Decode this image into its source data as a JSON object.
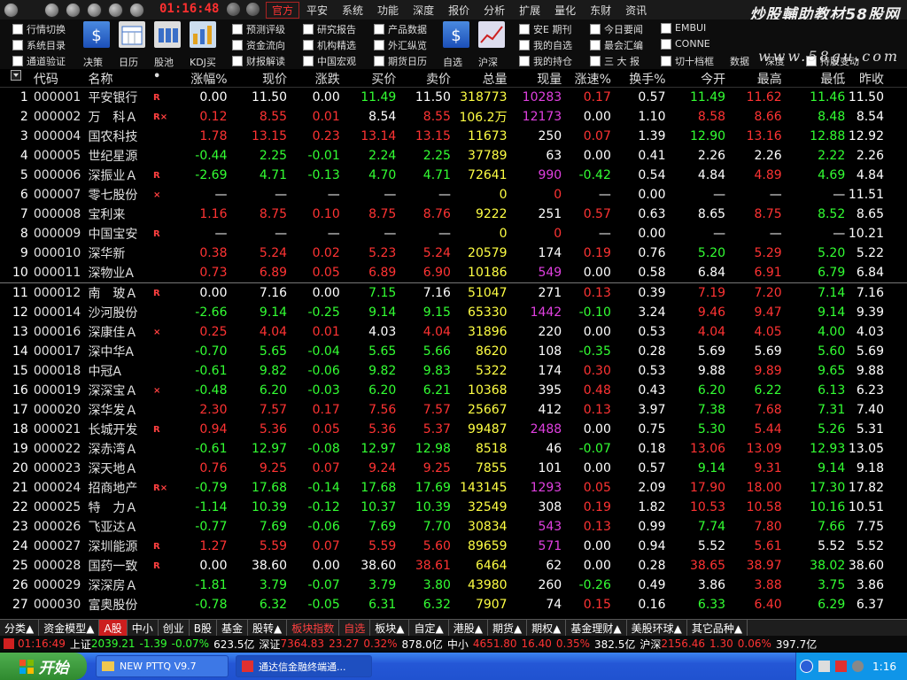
{
  "titlebar": {
    "clock": "01:16:48",
    "menu": [
      "官方",
      "平安",
      "系统",
      "功能",
      "深度",
      "报价",
      "分析",
      "扩展",
      "量化",
      "东财",
      "资讯"
    ],
    "brand": "炒股輔助教材58股网",
    "brand_url": "www.58gu.com"
  },
  "toolbar": {
    "checks_col1": [
      "行情切换",
      "系统目录",
      "通道验证"
    ],
    "tools1": [
      "决策",
      "日历",
      "股池",
      "KDJ买"
    ],
    "checks_col2": [
      "预测评级",
      "资金流向",
      "财报解读"
    ],
    "checks_col3": [
      "研究报告",
      "机构精选",
      "中国宏观"
    ],
    "checks_col4": [
      "产品数据",
      "外汇纵览",
      "期货日历"
    ],
    "tools2": [
      "自选",
      "沪深"
    ],
    "checks_col5": [
      "安E 期刊",
      "我的自选",
      "我的持仓"
    ],
    "checks_col6": [
      "今日要闻",
      "最会汇编",
      "三 大 报"
    ],
    "checks_col7": [
      "EMBUI",
      "CONNE",
      "切十档框"
    ],
    "extra_labels": [
      "数据",
      "深度"
    ],
    "check_last": "持股变动"
  },
  "columns": [
    "代码",
    "名称",
    "•",
    "涨幅%",
    "现价",
    "涨跌",
    "买价",
    "卖价",
    "总量",
    "现量",
    "涨速%",
    "换手%",
    "今开",
    "最高",
    "最低",
    "昨收"
  ],
  "rows": [
    {
      "i": "1",
      "code": "000001",
      "name": "平安银行",
      "mk": "R",
      "pct": "0.00",
      "price": "11.50",
      "chg": "0.00",
      "bid": "11.49",
      "ask": "11.50",
      "vol": "318773",
      "cur": "10283",
      "spd": "0.17",
      "turn": "0.57",
      "open": "11.49",
      "high": "11.62",
      "low": "11.46",
      "close": "11.50",
      "c": {
        "pct": "wh",
        "price": "wh",
        "chg": "wh",
        "bid": "dn",
        "ask": "wh",
        "vol": "yl",
        "cur": "mg",
        "spd": "up",
        "open": "dn",
        "high": "up",
        "low": "dn"
      }
    },
    {
      "i": "2",
      "code": "000002",
      "name": "万　科Ａ",
      "mk": "R×",
      "pct": "0.12",
      "price": "8.55",
      "chg": "0.01",
      "bid": "8.54",
      "ask": "8.55",
      "vol": "106.2万",
      "cur": "12173",
      "spd": "0.00",
      "turn": "1.10",
      "open": "8.58",
      "high": "8.66",
      "low": "8.48",
      "close": "8.54",
      "c": {
        "pct": "up",
        "price": "up",
        "chg": "up",
        "bid": "wh",
        "ask": "up",
        "vol": "yl",
        "cur": "mg",
        "spd": "wh",
        "open": "up",
        "high": "up",
        "low": "dn"
      }
    },
    {
      "i": "3",
      "code": "000004",
      "name": "国农科技",
      "mk": "",
      "pct": "1.78",
      "price": "13.15",
      "chg": "0.23",
      "bid": "13.14",
      "ask": "13.15",
      "vol": "11673",
      "cur": "250",
      "spd": "0.07",
      "turn": "1.39",
      "open": "12.90",
      "high": "13.16",
      "low": "12.88",
      "close": "12.92",
      "c": {
        "pct": "up",
        "price": "up",
        "chg": "up",
        "bid": "up",
        "ask": "up",
        "vol": "yl",
        "cur": "wh",
        "spd": "up",
        "open": "dn",
        "high": "up",
        "low": "dn"
      }
    },
    {
      "i": "4",
      "code": "000005",
      "name": "世纪星源",
      "mk": "",
      "pct": "-0.44",
      "price": "2.25",
      "chg": "-0.01",
      "bid": "2.24",
      "ask": "2.25",
      "vol": "37789",
      "cur": "63",
      "spd": "0.00",
      "turn": "0.41",
      "open": "2.26",
      "high": "2.26",
      "low": "2.22",
      "close": "2.26",
      "c": {
        "pct": "dn",
        "price": "dn",
        "chg": "dn",
        "bid": "dn",
        "ask": "dn",
        "vol": "yl",
        "cur": "wh",
        "spd": "wh",
        "open": "wh",
        "high": "wh",
        "low": "dn"
      }
    },
    {
      "i": "5",
      "code": "000006",
      "name": "深振业Ａ",
      "mk": "R",
      "pct": "-2.69",
      "price": "4.71",
      "chg": "-0.13",
      "bid": "4.70",
      "ask": "4.71",
      "vol": "72641",
      "cur": "990",
      "spd": "-0.42",
      "turn": "0.54",
      "open": "4.84",
      "high": "4.89",
      "low": "4.69",
      "close": "4.84",
      "c": {
        "pct": "dn",
        "price": "dn",
        "chg": "dn",
        "bid": "dn",
        "ask": "dn",
        "vol": "yl",
        "cur": "mg",
        "spd": "dn",
        "open": "wh",
        "high": "up",
        "low": "dn"
      }
    },
    {
      "i": "6",
      "code": "000007",
      "name": "零七股份",
      "mk": "×",
      "pct": "—",
      "price": "—",
      "chg": "—",
      "bid": "—",
      "ask": "—",
      "vol": "0",
      "cur": "0",
      "spd": "—",
      "turn": "0.00",
      "open": "—",
      "high": "—",
      "low": "—",
      "close": "11.51",
      "c": {
        "pct": "wh",
        "price": "wh",
        "chg": "wh",
        "bid": "wh",
        "ask": "wh",
        "vol": "yl",
        "cur": "up",
        "spd": "wh",
        "open": "wh",
        "high": "wh",
        "low": "wh"
      }
    },
    {
      "i": "7",
      "code": "000008",
      "name": "宝利来",
      "mk": "",
      "pct": "1.16",
      "price": "8.75",
      "chg": "0.10",
      "bid": "8.75",
      "ask": "8.76",
      "vol": "9222",
      "cur": "251",
      "spd": "0.57",
      "turn": "0.63",
      "open": "8.65",
      "high": "8.75",
      "low": "8.52",
      "close": "8.65",
      "c": {
        "pct": "up",
        "price": "up",
        "chg": "up",
        "bid": "up",
        "ask": "up",
        "vol": "yl",
        "cur": "wh",
        "spd": "up",
        "open": "wh",
        "high": "up",
        "low": "dn"
      }
    },
    {
      "i": "8",
      "code": "000009",
      "name": "中国宝安",
      "mk": "R",
      "pct": "—",
      "price": "—",
      "chg": "—",
      "bid": "—",
      "ask": "—",
      "vol": "0",
      "cur": "0",
      "spd": "—",
      "turn": "0.00",
      "open": "—",
      "high": "—",
      "low": "—",
      "close": "10.21",
      "c": {
        "pct": "wh",
        "price": "wh",
        "chg": "wh",
        "bid": "wh",
        "ask": "wh",
        "vol": "yl",
        "cur": "up",
        "spd": "wh",
        "open": "wh",
        "high": "wh",
        "low": "wh"
      }
    },
    {
      "i": "9",
      "code": "000010",
      "name": "深华新",
      "mk": "",
      "pct": "0.38",
      "price": "5.24",
      "chg": "0.02",
      "bid": "5.23",
      "ask": "5.24",
      "vol": "20579",
      "cur": "174",
      "spd": "0.19",
      "turn": "0.76",
      "open": "5.20",
      "high": "5.29",
      "low": "5.20",
      "close": "5.22",
      "c": {
        "pct": "up",
        "price": "up",
        "chg": "up",
        "bid": "up",
        "ask": "up",
        "vol": "yl",
        "cur": "wh",
        "spd": "up",
        "open": "dn",
        "high": "up",
        "low": "dn"
      }
    },
    {
      "i": "10",
      "code": "000011",
      "name": "深物业A",
      "mk": "",
      "pct": "0.73",
      "price": "6.89",
      "chg": "0.05",
      "bid": "6.89",
      "ask": "6.90",
      "vol": "10186",
      "cur": "549",
      "spd": "0.00",
      "turn": "0.58",
      "open": "6.84",
      "high": "6.91",
      "low": "6.79",
      "close": "6.84",
      "c": {
        "pct": "up",
        "price": "up",
        "chg": "up",
        "bid": "up",
        "ask": "up",
        "vol": "yl",
        "cur": "mg",
        "spd": "wh",
        "open": "wh",
        "high": "up",
        "low": "dn"
      }
    },
    {
      "i": "11",
      "code": "000012",
      "name": "南　玻Ａ",
      "mk": "R",
      "pct": "0.00",
      "price": "7.16",
      "chg": "0.00",
      "bid": "7.15",
      "ask": "7.16",
      "vol": "51047",
      "cur": "271",
      "spd": "0.13",
      "turn": "0.39",
      "open": "7.19",
      "high": "7.20",
      "low": "7.14",
      "close": "7.16",
      "c": {
        "pct": "wh",
        "price": "wh",
        "chg": "wh",
        "bid": "dn",
        "ask": "wh",
        "vol": "yl",
        "cur": "wh",
        "spd": "up",
        "open": "up",
        "high": "up",
        "low": "dn"
      }
    },
    {
      "i": "12",
      "code": "000014",
      "name": "沙河股份",
      "mk": "",
      "pct": "-2.66",
      "price": "9.14",
      "chg": "-0.25",
      "bid": "9.14",
      "ask": "9.15",
      "vol": "65330",
      "cur": "1442",
      "spd": "-0.10",
      "turn": "3.24",
      "open": "9.46",
      "high": "9.47",
      "low": "9.14",
      "close": "9.39",
      "c": {
        "pct": "dn",
        "price": "dn",
        "chg": "dn",
        "bid": "dn",
        "ask": "dn",
        "vol": "yl",
        "cur": "mg",
        "spd": "dn",
        "open": "up",
        "high": "up",
        "low": "dn"
      }
    },
    {
      "i": "13",
      "code": "000016",
      "name": "深康佳Ａ",
      "mk": "×",
      "pct": "0.25",
      "price": "4.04",
      "chg": "0.01",
      "bid": "4.03",
      "ask": "4.04",
      "vol": "31896",
      "cur": "220",
      "spd": "0.00",
      "turn": "0.53",
      "open": "4.04",
      "high": "4.05",
      "low": "4.00",
      "close": "4.03",
      "c": {
        "pct": "up",
        "price": "up",
        "chg": "up",
        "bid": "wh",
        "ask": "up",
        "vol": "yl",
        "cur": "wh",
        "spd": "wh",
        "open": "up",
        "high": "up",
        "low": "dn"
      }
    },
    {
      "i": "14",
      "code": "000017",
      "name": "深中华A",
      "mk": "",
      "pct": "-0.70",
      "price": "5.65",
      "chg": "-0.04",
      "bid": "5.65",
      "ask": "5.66",
      "vol": "8620",
      "cur": "108",
      "spd": "-0.35",
      "turn": "0.28",
      "open": "5.69",
      "high": "5.69",
      "low": "5.60",
      "close": "5.69",
      "c": {
        "pct": "dn",
        "price": "dn",
        "chg": "dn",
        "bid": "dn",
        "ask": "dn",
        "vol": "yl",
        "cur": "wh",
        "spd": "dn",
        "open": "wh",
        "high": "wh",
        "low": "dn"
      }
    },
    {
      "i": "15",
      "code": "000018",
      "name": "中冠A",
      "mk": "",
      "pct": "-0.61",
      "price": "9.82",
      "chg": "-0.06",
      "bid": "9.82",
      "ask": "9.83",
      "vol": "5322",
      "cur": "174",
      "spd": "0.30",
      "turn": "0.53",
      "open": "9.88",
      "high": "9.89",
      "low": "9.65",
      "close": "9.88",
      "c": {
        "pct": "dn",
        "price": "dn",
        "chg": "dn",
        "bid": "dn",
        "ask": "dn",
        "vol": "yl",
        "cur": "wh",
        "spd": "up",
        "open": "wh",
        "high": "up",
        "low": "dn"
      }
    },
    {
      "i": "16",
      "code": "000019",
      "name": "深深宝Ａ",
      "mk": "×",
      "pct": "-0.48",
      "price": "6.20",
      "chg": "-0.03",
      "bid": "6.20",
      "ask": "6.21",
      "vol": "10368",
      "cur": "395",
      "spd": "0.48",
      "turn": "0.43",
      "open": "6.20",
      "high": "6.22",
      "low": "6.13",
      "close": "6.23",
      "c": {
        "pct": "dn",
        "price": "dn",
        "chg": "dn",
        "bid": "dn",
        "ask": "dn",
        "vol": "yl",
        "cur": "wh",
        "spd": "up",
        "open": "dn",
        "high": "dn",
        "low": "dn"
      }
    },
    {
      "i": "17",
      "code": "000020",
      "name": "深华发Ａ",
      "mk": "",
      "pct": "2.30",
      "price": "7.57",
      "chg": "0.17",
      "bid": "7.56",
      "ask": "7.57",
      "vol": "25667",
      "cur": "412",
      "spd": "0.13",
      "turn": "3.97",
      "open": "7.38",
      "high": "7.68",
      "low": "7.31",
      "close": "7.40",
      "c": {
        "pct": "up",
        "price": "up",
        "chg": "up",
        "bid": "up",
        "ask": "up",
        "vol": "yl",
        "cur": "wh",
        "spd": "up",
        "open": "dn",
        "high": "up",
        "low": "dn"
      }
    },
    {
      "i": "18",
      "code": "000021",
      "name": "长城开发",
      "mk": "R",
      "pct": "0.94",
      "price": "5.36",
      "chg": "0.05",
      "bid": "5.36",
      "ask": "5.37",
      "vol": "99487",
      "cur": "2488",
      "spd": "0.00",
      "turn": "0.75",
      "open": "5.30",
      "high": "5.44",
      "low": "5.26",
      "close": "5.31",
      "c": {
        "pct": "up",
        "price": "up",
        "chg": "up",
        "bid": "up",
        "ask": "up",
        "vol": "yl",
        "cur": "mg",
        "spd": "wh",
        "open": "dn",
        "high": "up",
        "low": "dn"
      }
    },
    {
      "i": "19",
      "code": "000022",
      "name": "深赤湾Ａ",
      "mk": "",
      "pct": "-0.61",
      "price": "12.97",
      "chg": "-0.08",
      "bid": "12.97",
      "ask": "12.98",
      "vol": "8518",
      "cur": "46",
      "spd": "-0.07",
      "turn": "0.18",
      "open": "13.06",
      "high": "13.09",
      "low": "12.93",
      "close": "13.05",
      "c": {
        "pct": "dn",
        "price": "dn",
        "chg": "dn",
        "bid": "dn",
        "ask": "dn",
        "vol": "yl",
        "cur": "wh",
        "spd": "dn",
        "open": "up",
        "high": "up",
        "low": "dn"
      }
    },
    {
      "i": "20",
      "code": "000023",
      "name": "深天地Ａ",
      "mk": "",
      "pct": "0.76",
      "price": "9.25",
      "chg": "0.07",
      "bid": "9.24",
      "ask": "9.25",
      "vol": "7855",
      "cur": "101",
      "spd": "0.00",
      "turn": "0.57",
      "open": "9.14",
      "high": "9.31",
      "low": "9.14",
      "close": "9.18",
      "c": {
        "pct": "up",
        "price": "up",
        "chg": "up",
        "bid": "up",
        "ask": "up",
        "vol": "yl",
        "cur": "wh",
        "spd": "wh",
        "open": "dn",
        "high": "up",
        "low": "dn"
      }
    },
    {
      "i": "21",
      "code": "000024",
      "name": "招商地产",
      "mk": "R×",
      "pct": "-0.79",
      "price": "17.68",
      "chg": "-0.14",
      "bid": "17.68",
      "ask": "17.69",
      "vol": "143145",
      "cur": "1293",
      "spd": "0.05",
      "turn": "2.09",
      "open": "17.90",
      "high": "18.00",
      "low": "17.30",
      "close": "17.82",
      "c": {
        "pct": "dn",
        "price": "dn",
        "chg": "dn",
        "bid": "dn",
        "ask": "dn",
        "vol": "yl",
        "cur": "mg",
        "spd": "up",
        "open": "up",
        "high": "up",
        "low": "dn"
      }
    },
    {
      "i": "22",
      "code": "000025",
      "name": "特　力Ａ",
      "mk": "",
      "pct": "-1.14",
      "price": "10.39",
      "chg": "-0.12",
      "bid": "10.37",
      "ask": "10.39",
      "vol": "32549",
      "cur": "308",
      "spd": "0.19",
      "turn": "1.82",
      "open": "10.53",
      "high": "10.58",
      "low": "10.16",
      "close": "10.51",
      "c": {
        "pct": "dn",
        "price": "dn",
        "chg": "dn",
        "bid": "dn",
        "ask": "dn",
        "vol": "yl",
        "cur": "wh",
        "spd": "up",
        "open": "up",
        "high": "up",
        "low": "dn"
      }
    },
    {
      "i": "23",
      "code": "000026",
      "name": "飞亚达Ａ",
      "mk": "",
      "pct": "-0.77",
      "price": "7.69",
      "chg": "-0.06",
      "bid": "7.69",
      "ask": "7.70",
      "vol": "30834",
      "cur": "543",
      "spd": "0.13",
      "turn": "0.99",
      "open": "7.74",
      "high": "7.80",
      "low": "7.66",
      "close": "7.75",
      "c": {
        "pct": "dn",
        "price": "dn",
        "chg": "dn",
        "bid": "dn",
        "ask": "dn",
        "vol": "yl",
        "cur": "mg",
        "spd": "up",
        "open": "dn",
        "high": "up",
        "low": "dn"
      }
    },
    {
      "i": "24",
      "code": "000027",
      "name": "深圳能源",
      "mk": "R",
      "pct": "1.27",
      "price": "5.59",
      "chg": "0.07",
      "bid": "5.59",
      "ask": "5.60",
      "vol": "89659",
      "cur": "571",
      "spd": "0.00",
      "turn": "0.94",
      "open": "5.52",
      "high": "5.61",
      "low": "5.52",
      "close": "5.52",
      "c": {
        "pct": "up",
        "price": "up",
        "chg": "up",
        "bid": "up",
        "ask": "up",
        "vol": "yl",
        "cur": "mg",
        "spd": "wh",
        "open": "wh",
        "high": "up",
        "low": "wh"
      }
    },
    {
      "i": "25",
      "code": "000028",
      "name": "国药一致",
      "mk": "R",
      "pct": "0.00",
      "price": "38.60",
      "chg": "0.00",
      "bid": "38.60",
      "ask": "38.61",
      "vol": "6464",
      "cur": "62",
      "spd": "0.00",
      "turn": "0.28",
      "open": "38.65",
      "high": "38.97",
      "low": "38.02",
      "close": "38.60",
      "c": {
        "pct": "wh",
        "price": "wh",
        "chg": "wh",
        "bid": "wh",
        "ask": "up",
        "vol": "yl",
        "cur": "wh",
        "spd": "wh",
        "open": "up",
        "high": "up",
        "low": "dn"
      }
    },
    {
      "i": "26",
      "code": "000029",
      "name": "深深房Ａ",
      "mk": "",
      "pct": "-1.81",
      "price": "3.79",
      "chg": "-0.07",
      "bid": "3.79",
      "ask": "3.80",
      "vol": "43980",
      "cur": "260",
      "spd": "-0.26",
      "turn": "0.49",
      "open": "3.86",
      "high": "3.88",
      "low": "3.75",
      "close": "3.86",
      "c": {
        "pct": "dn",
        "price": "dn",
        "chg": "dn",
        "bid": "dn",
        "ask": "dn",
        "vol": "yl",
        "cur": "wh",
        "spd": "dn",
        "open": "wh",
        "high": "up",
        "low": "dn"
      }
    },
    {
      "i": "27",
      "code": "000030",
      "name": "富奥股份",
      "mk": "",
      "pct": "-0.78",
      "price": "6.32",
      "chg": "-0.05",
      "bid": "6.31",
      "ask": "6.32",
      "vol": "7907",
      "cur": "74",
      "spd": "0.15",
      "turn": "0.16",
      "open": "6.33",
      "high": "6.40",
      "low": "6.29",
      "close": "6.37",
      "c": {
        "pct": "dn",
        "price": "dn",
        "chg": "dn",
        "bid": "dn",
        "ask": "dn",
        "vol": "yl",
        "cur": "wh",
        "spd": "up",
        "open": "dn",
        "high": "up",
        "low": "dn"
      }
    }
  ],
  "tabs": [
    "分类▲",
    "资金模型▲",
    "A股",
    "中小",
    "创业",
    "B股",
    "基金",
    "股转▲",
    "板块指数",
    "自选",
    "板块▲",
    "自定▲",
    "港股▲",
    "期货▲",
    "期权▲",
    "基金理财▲",
    "美股环球▲",
    "其它品种▲"
  ],
  "status": {
    "time": "01:16:49",
    "sh_label": "上证",
    "sh_val": "2039.21",
    "sh_chg": "-1.39",
    "sh_pct": "-0.07%",
    "sh_amt": "623.5亿",
    "sz_label": "深证",
    "sz_val": "7364.83",
    "sz_chg": "23.27",
    "sz_pct": "0.32%",
    "sz_amt": "878.0亿",
    "zx_label": "中小",
    "zx_val": "4651.80",
    "zx_chg": "16.40",
    "zx_pct": "0.35%",
    "zx_amt": "382.5亿",
    "hs_label": "沪深",
    "hs_val": "2156.46",
    "hs_chg": "1.30",
    "hs_pct": "0.06%",
    "hs_amt": "397.7亿"
  },
  "taskbar": {
    "start": "开始",
    "task1": "NEW PTTQ V9.7",
    "task2": "通达信金融终端通...",
    "clock": "1:16"
  }
}
